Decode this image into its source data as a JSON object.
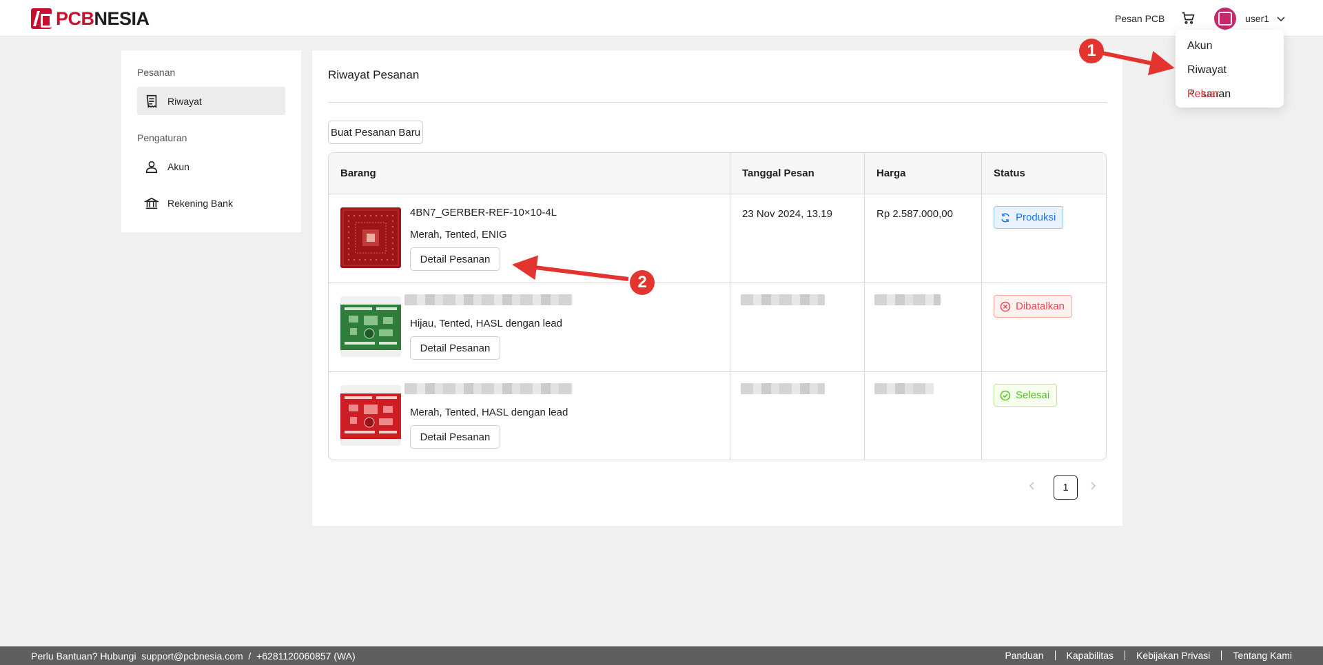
{
  "header": {
    "logo_text_pcb": "PCB",
    "logo_text_nesia": "NESIA",
    "nav_pesan": "Pesan PCB",
    "username": "user1"
  },
  "dropdown": {
    "items": [
      "Akun",
      "Riwayat Pesanan",
      "Keluar"
    ]
  },
  "sidebar": {
    "group_pesanan": "Pesanan",
    "item_riwayat": "Riwayat",
    "group_pengaturan": "Pengaturan",
    "item_akun": "Akun",
    "item_rekening": "Rekening Bank"
  },
  "main": {
    "title": "Riwayat Pesanan",
    "new_order_label": "Buat Pesanan Baru",
    "columns": [
      "Barang",
      "Tanggal Pesan",
      "Harga",
      "Status"
    ],
    "orders": [
      {
        "name": "4BN7_GERBER-REF-10×10-4L",
        "spec": "Merah, Tented, ENIG",
        "date": "23 Nov 2024, 13.19",
        "price": "Rp 2.587.000,00",
        "status": "Produksi",
        "detail_label": "Detail Pesanan"
      },
      {
        "name": "",
        "spec": "Hijau, Tented, HASL dengan lead",
        "date": "",
        "price": "",
        "status": "Dibatalkan",
        "detail_label": "Detail Pesanan"
      },
      {
        "name": "",
        "spec": "Merah, Tented, HASL dengan lead",
        "date": "",
        "price": "",
        "status": "Selesai",
        "detail_label": "Detail Pesanan"
      }
    ],
    "current_page": "1"
  },
  "annotations": [
    "1",
    "2"
  ],
  "footer": {
    "help_text": "Perlu Bantuan? Hubungi  support@pcbnesia.com  /  +6281120060857 (WA)",
    "links": [
      "Panduan",
      "Kapabilitas",
      "Kebijakan Privasi",
      "Tentang Kami"
    ]
  },
  "colors": {
    "brand_red": "#c8102e",
    "annotation_red": "#e3342f",
    "status_blue": "#1677ff",
    "status_red": "#e5484d",
    "status_green": "#52c41a"
  }
}
